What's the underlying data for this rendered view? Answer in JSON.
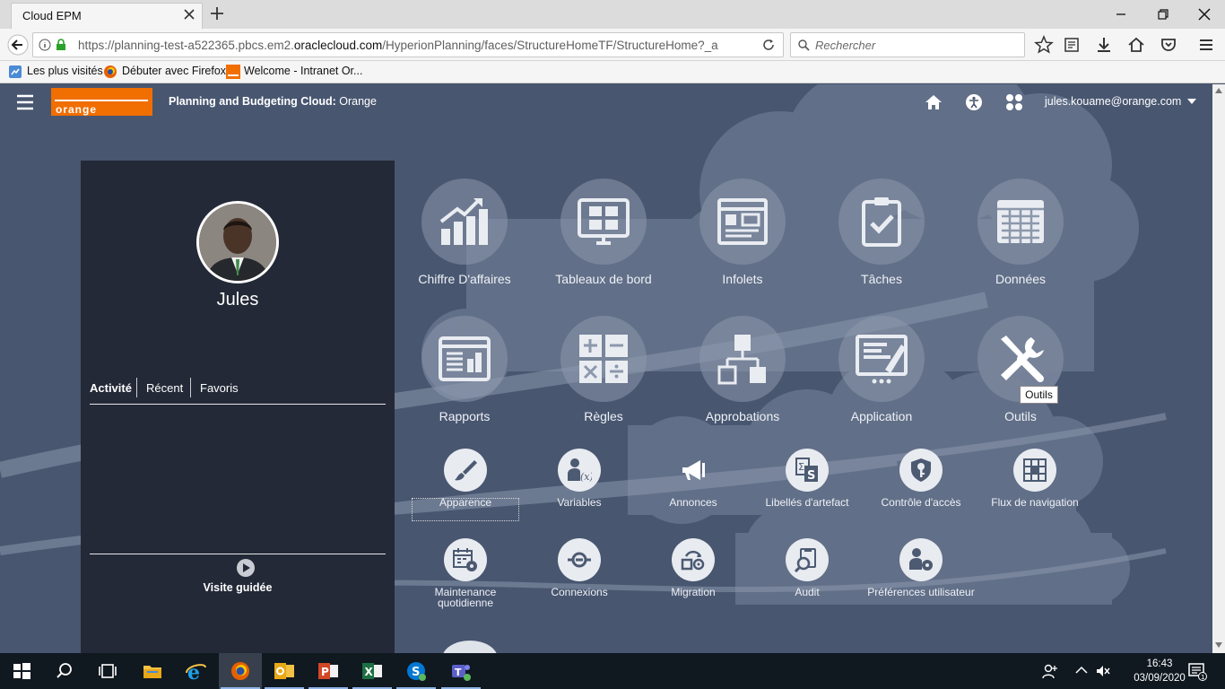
{
  "browser": {
    "tab_title": "Cloud EPM",
    "url_prefix": "https://planning-test-a522365.pbcs.em2.",
    "url_domain": "oraclecloud.com",
    "url_suffix": "/HyperionPlanning/faces/StructureHomeTF/StructureHome?_a",
    "search_placeholder": "Rechercher",
    "bookmarks": [
      "Les plus visités",
      "Débuter avec Firefox",
      "Welcome - Intranet Or..."
    ]
  },
  "header": {
    "logo_text": "orange",
    "product_bold": "Planning and Budgeting Cloud:",
    "product_rest": " Orange",
    "user_email": "jules.kouame@orange.com"
  },
  "panel": {
    "user_name": "Jules",
    "tabs": [
      "Activité",
      "Récent",
      "Favoris"
    ],
    "tour_label": "Visite guidée"
  },
  "cards_row1": [
    {
      "label": "Chiffre D'affaires",
      "icon": "bar-chart-icon"
    },
    {
      "label": "Tableaux de bord",
      "icon": "dashboard-icon"
    },
    {
      "label": "Infolets",
      "icon": "infolets-icon"
    },
    {
      "label": "Tâches",
      "icon": "clipboard-check-icon"
    },
    {
      "label": "Données",
      "icon": "data-grid-icon"
    }
  ],
  "cards_row2": [
    {
      "label": "Rapports",
      "icon": "report-icon"
    },
    {
      "label": "Règles",
      "icon": "calculator-icon"
    },
    {
      "label": "Approbations",
      "icon": "hierarchy-icon"
    },
    {
      "label": "Application",
      "icon": "application-icon"
    },
    {
      "label": "Outils",
      "icon": "tools-icon"
    }
  ],
  "tools_row1": [
    {
      "label": "Apparence",
      "icon": "brush-icon"
    },
    {
      "label": "Variables",
      "icon": "user-variable-icon"
    },
    {
      "label": "Annonces",
      "icon": "megaphone-icon"
    },
    {
      "label": "Libellés d'artefact",
      "icon": "artifact-labels-icon"
    },
    {
      "label": "Contrôle d'accès",
      "icon": "shield-key-icon"
    },
    {
      "label": "Flux de navigation",
      "icon": "grid-flow-icon"
    }
  ],
  "tools_row2": [
    {
      "label": "Maintenance quotidienne",
      "icon": "calendar-gear-icon"
    },
    {
      "label": "Connexions",
      "icon": "connection-icon"
    },
    {
      "label": "Migration",
      "icon": "migration-icon"
    },
    {
      "label": "Audit",
      "icon": "audit-icon"
    },
    {
      "label": "Préférences utilisateur",
      "icon": "user-gear-icon"
    }
  ],
  "tooltip": "Outils",
  "taskbar": {
    "time": "16:43",
    "date": "03/09/2020"
  },
  "colors": {
    "app_bg": "#485670",
    "panel_bg": "#232937",
    "orange": "#f16e00",
    "taskbar_bg": "#101820"
  }
}
